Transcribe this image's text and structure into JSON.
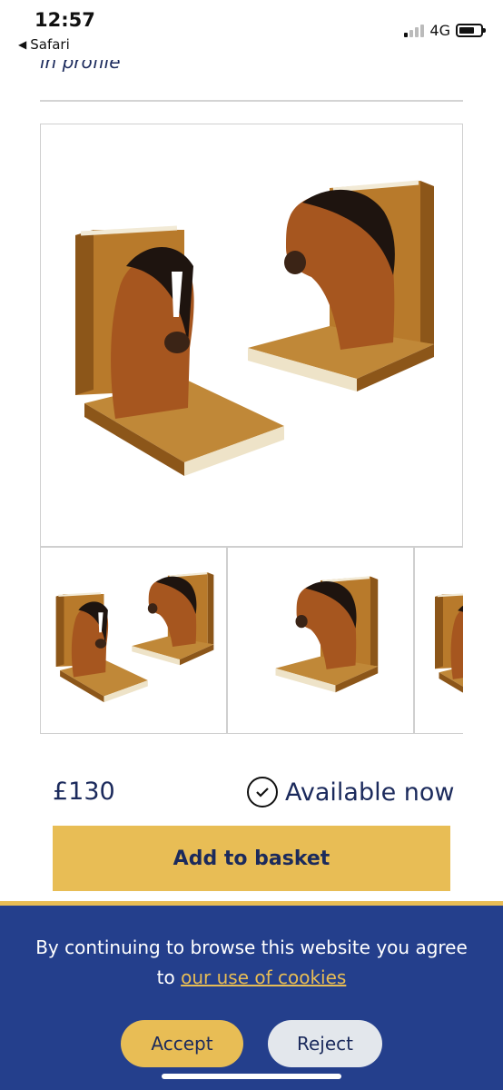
{
  "status_bar": {
    "time": "12:57",
    "back_app": "Safari",
    "network": "4G"
  },
  "page": {
    "cut_text": "in profile"
  },
  "product": {
    "main_image": "horse-head-bookends-pair",
    "thumbnails": [
      "bookends-pair-thumb",
      "single-bookend-thumb",
      "bookend-partial-thumb"
    ],
    "price": "£130",
    "availability": "Available now",
    "add_to_basket": "Add to basket"
  },
  "cookie_banner": {
    "message": "By continuing to browse this website you agree",
    "message_line2_prefix": "to ",
    "link_text": "our use of cookies",
    "accept": "Accept",
    "reject": "Reject"
  },
  "colors": {
    "navy": "#1b2a5c",
    "gold": "#e8bd55",
    "banner_blue": "#243f8c",
    "reject_grey": "#e3e7ec"
  }
}
